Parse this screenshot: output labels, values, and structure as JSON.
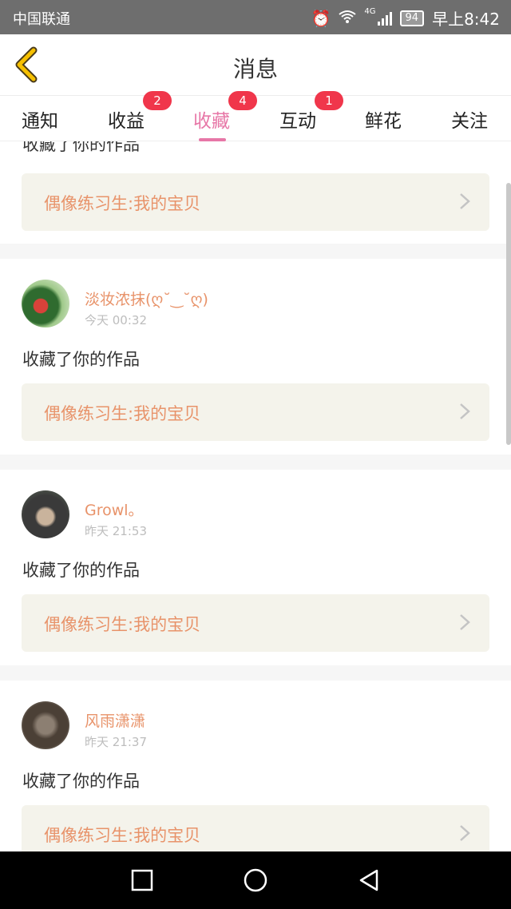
{
  "status_bar": {
    "carrier": "中国联通",
    "network": "4G",
    "battery": "94",
    "time": "早上8:42"
  },
  "header": {
    "title": "消息",
    "back_icon": "chevron-left-icon",
    "accent_color": "#f6c000"
  },
  "tabs": [
    {
      "label": "通知",
      "badge": ""
    },
    {
      "label": "收益",
      "badge": "2"
    },
    {
      "label": "收藏",
      "badge": "4",
      "active": true
    },
    {
      "label": "互动",
      "badge": "1"
    },
    {
      "label": "鲜花",
      "badge": ""
    },
    {
      "label": "关注",
      "badge": ""
    }
  ],
  "feed": {
    "partial_top": {
      "action": "收藏了你的作品",
      "work_title": "偶像练习生:我的宝贝"
    },
    "items": [
      {
        "username": "淡妆浓抹(ღ˘‿˘ღ)",
        "time": "今天 00:32",
        "action": "收藏了你的作品",
        "work_title": "偶像练习生:我的宝贝"
      },
      {
        "username": "Growl。",
        "time": "昨天 21:53",
        "action": "收藏了你的作品",
        "work_title": "偶像练习生:我的宝贝"
      },
      {
        "username": "风雨潇潇",
        "time": "昨天 21:37",
        "action": "收藏了你的作品",
        "work_title": "偶像练习生:我的宝贝"
      }
    ]
  },
  "colors": {
    "active_tab": "#e777a7",
    "badge": "#f0364b",
    "username": "#e8936a",
    "work_bg": "#f4f3eb"
  },
  "nav": {
    "recent": "square-icon",
    "home": "circle-icon",
    "back": "triangle-back-icon"
  }
}
